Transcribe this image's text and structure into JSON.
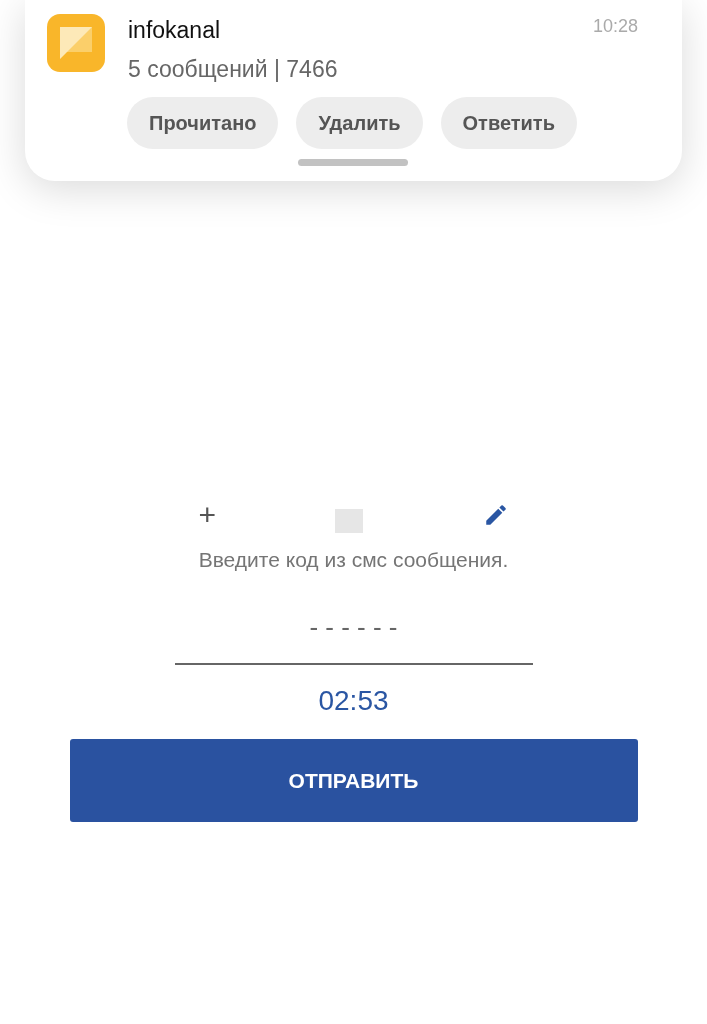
{
  "notification": {
    "app": "infokanal",
    "text": "5 сообщений | 7466",
    "time": "10:28",
    "actions": [
      "Прочитано",
      "Удалить",
      "Ответить"
    ]
  },
  "phone": {
    "prefix": "+"
  },
  "instruction": "Введите код из смс сообщения.",
  "code_field": {
    "placeholder": "- - - - - -"
  },
  "timer": "02:53",
  "submit_button": "ОТПРАВИТЬ"
}
